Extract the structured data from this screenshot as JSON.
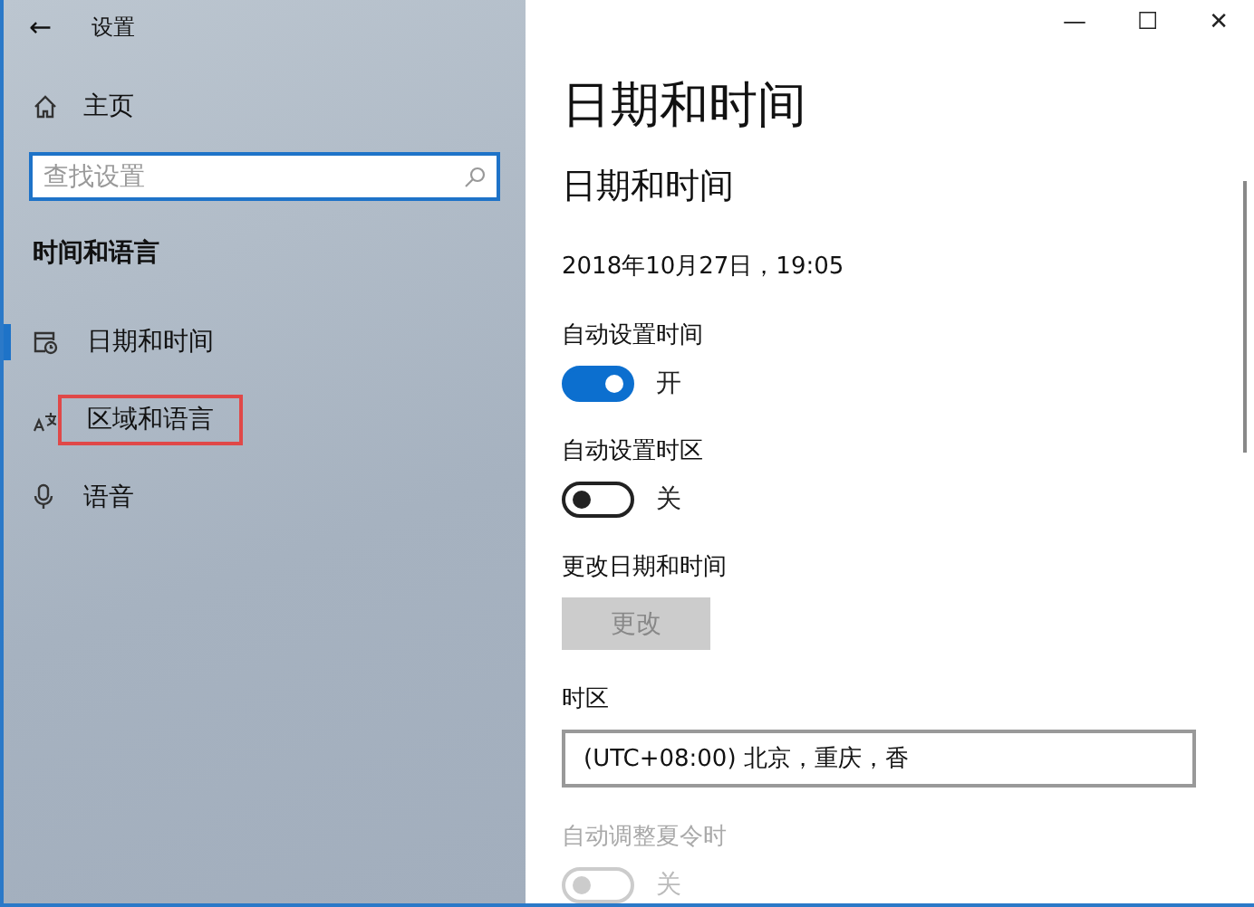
{
  "window": {
    "title": "设置",
    "back": "←",
    "controls": [
      "—",
      "☐",
      "✕"
    ]
  },
  "sidebar": {
    "home": "主页",
    "search": {
      "placeholder": "查找设置"
    },
    "section": "时间和语言",
    "items": [
      {
        "label": "日期和时间",
        "kind": "calendar",
        "selected": true,
        "highlighted": false
      },
      {
        "label": "区域和语言",
        "kind": "language",
        "selected": false,
        "highlighted": true
      },
      {
        "label": "语音",
        "kind": "microphone",
        "selected": false,
        "highlighted": false
      }
    ]
  },
  "content": {
    "title": "日期和时间",
    "subtitle": "日期和时间",
    "current": "2018年10月27日，19:05",
    "settings": [
      {
        "kind": "toggle",
        "label": "自动设置时间",
        "on": true,
        "state": "开",
        "disabled": false
      },
      {
        "kind": "toggle",
        "label": "自动设置时区",
        "on": false,
        "state": "关",
        "disabled": false
      },
      {
        "kind": "button",
        "label": "更改日期和时间",
        "button": "更改",
        "disabled": true
      },
      {
        "kind": "dropdown",
        "label": "时区",
        "value": "(UTC+08:00) 北京，重庆，香"
      },
      {
        "kind": "toggle",
        "label": "自动调整夏令时",
        "on": false,
        "state": "关",
        "disabled": true
      }
    ]
  }
}
